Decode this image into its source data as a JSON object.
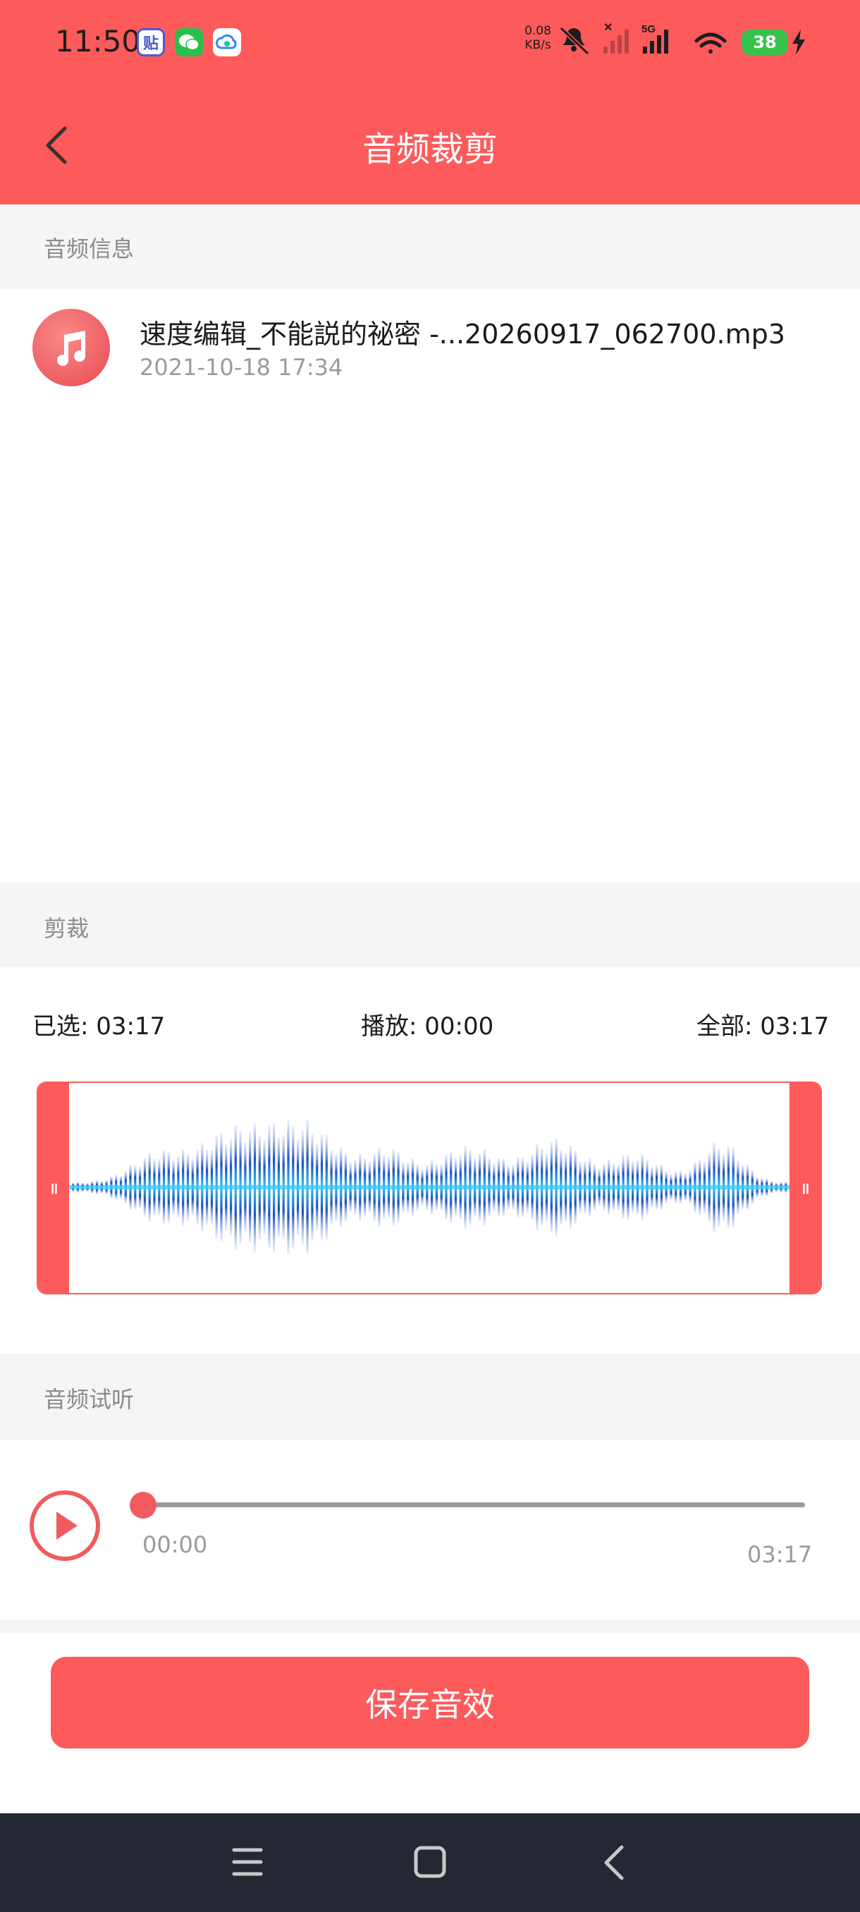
{
  "status_bar": {
    "time": "11:50",
    "apps": [
      {
        "name": "tieba-icon",
        "glyph": "贴",
        "color": "#4a5ad6"
      },
      {
        "name": "wechat-icon",
        "glyph": "",
        "color": "#29c04a"
      },
      {
        "name": "cloud-icon",
        "glyph": "",
        "color": "#2a8cf0"
      }
    ],
    "net_speed_value": "0.08",
    "net_speed_unit": "KB/s",
    "network_type": "5G",
    "battery_level": "38"
  },
  "header": {
    "title": "音频裁剪",
    "background": "#fd5a5b"
  },
  "sections": {
    "info": "音频信息",
    "crop": "剪裁",
    "preview": "音频试听"
  },
  "audio": {
    "file_name": "速度编辑_不能説的祕密 -...20260917_062700.mp3",
    "date": "2021-10-18 17:34"
  },
  "crop": {
    "selected_label": "已选: 03:17",
    "playback_label": "播放: 00:00",
    "total_label": "全部: 03:17",
    "handle_glyph": "॥"
  },
  "preview": {
    "position": "00:00",
    "duration": "03:17",
    "progress_fraction": 0
  },
  "save_button": "保存音效",
  "colors": {
    "accent": "#fd5a5b",
    "wave_dark": "#1a4fc4",
    "wave_light": "#33c3f5"
  }
}
